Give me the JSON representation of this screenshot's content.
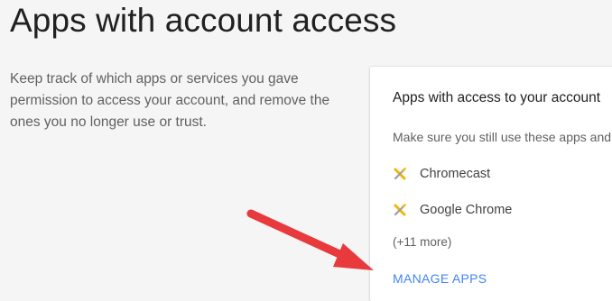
{
  "page": {
    "title": "Apps with account access",
    "description": "Keep track of which apps or services you gave permission to access your account, and remove the ones you no longer use or trust."
  },
  "card": {
    "title": "Apps with access to your account",
    "subtitle": "Make sure you still use these apps and",
    "apps": [
      {
        "name": "Chromecast",
        "icon": "chromecast-app-icon"
      },
      {
        "name": "Google Chrome",
        "icon": "chrome-app-icon"
      }
    ],
    "more": "(+11 more)",
    "manage_label": "MANAGE APPS"
  },
  "annotation": {
    "arrow_color": "#e8393c",
    "arrow_icon": "red-pointer-arrow"
  },
  "colors": {
    "link": "#4285f4",
    "background": "#f5f5f5",
    "card": "#ffffff"
  }
}
